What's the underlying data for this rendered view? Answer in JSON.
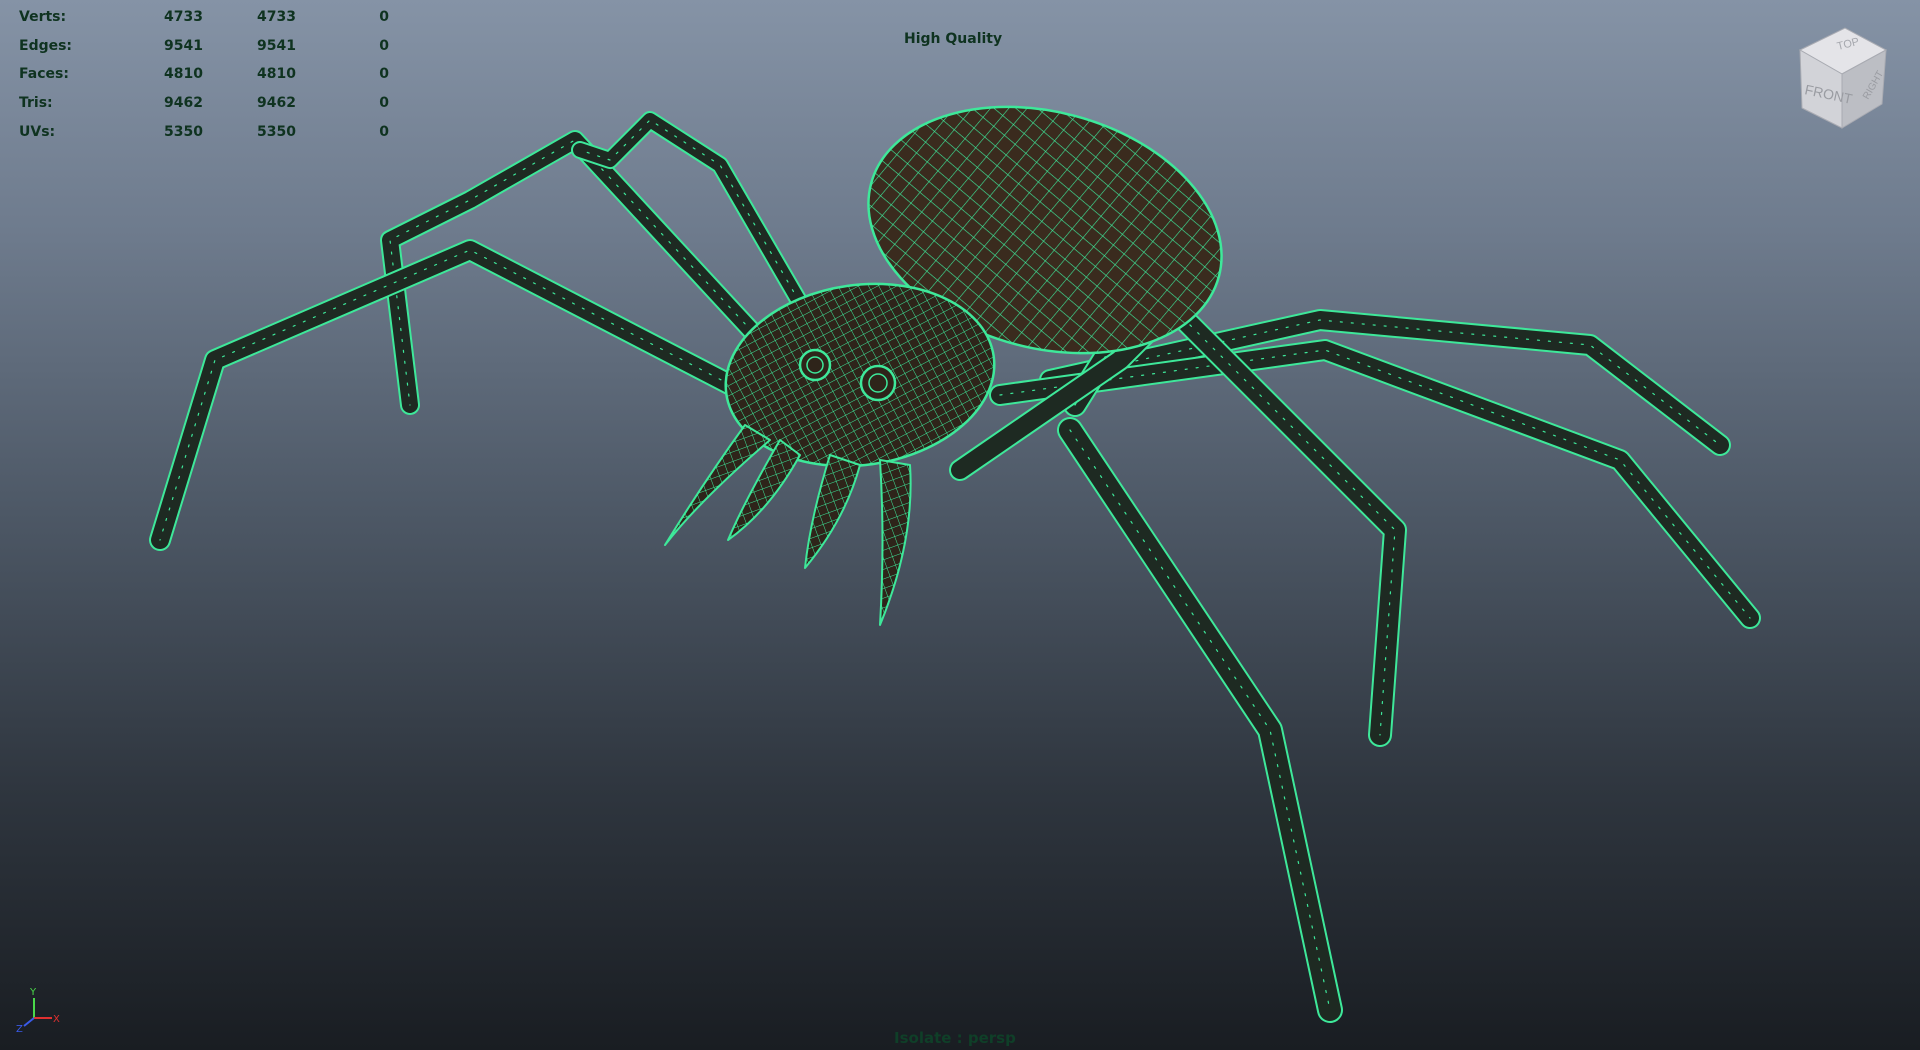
{
  "hud": {
    "rows": [
      {
        "label": "Verts:",
        "a": "4733",
        "b": "4733",
        "c": "0"
      },
      {
        "label": "Edges:",
        "a": "9541",
        "b": "9541",
        "c": "0"
      },
      {
        "label": "Faces:",
        "a": "4810",
        "b": "4810",
        "c": "0"
      },
      {
        "label": "Tris:",
        "a": "9462",
        "b": "9462",
        "c": "0"
      },
      {
        "label": "UVs:",
        "a": "5350",
        "b": "5350",
        "c": "0"
      }
    ]
  },
  "viewport": {
    "quality_label": "High Quality",
    "camera_label": "Isolate : persp",
    "wire_color": "#3ee89a",
    "body_color": "#3a2b1e"
  },
  "viewcube": {
    "top": "TOP",
    "front": "FRONT",
    "right": "RIGHT"
  },
  "axis": {
    "x": "X",
    "y": "Y",
    "z": "Z"
  }
}
